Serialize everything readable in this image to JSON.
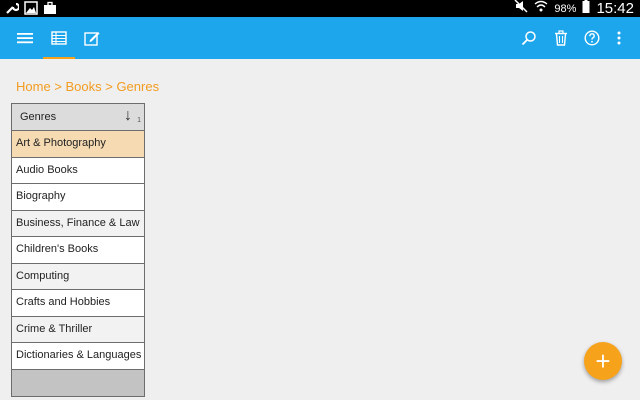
{
  "status_bar": {
    "battery_percent": "98%",
    "time": "15:42",
    "left_icons": [
      "wrench-icon",
      "image-icon",
      "briefcase-icon"
    ],
    "right_icons": [
      "mute-icon",
      "wifi-icon",
      "battery-icon"
    ]
  },
  "toolbar": {
    "icons": [
      "menu-icon",
      "table-view-icon",
      "edit-icon",
      "search-icon",
      "delete-icon",
      "help-icon",
      "overflow-icon"
    ],
    "background": "#1ea6ec",
    "accent": "#f7a21b"
  },
  "breadcrumb": {
    "text": "Home > Books > Genres"
  },
  "genres_list": {
    "header": "Genres",
    "sort_indicator": "↓",
    "sort_order": "1",
    "selected_index": 0,
    "items": [
      "Art & Photography",
      "Audio Books",
      "Biography",
      "Business, Finance & Law",
      "Children's Books",
      "Computing",
      "Crafts and Hobbies",
      "Crime & Thriller",
      "Dictionaries & Languages"
    ]
  },
  "fab": {
    "symbol": "+"
  }
}
